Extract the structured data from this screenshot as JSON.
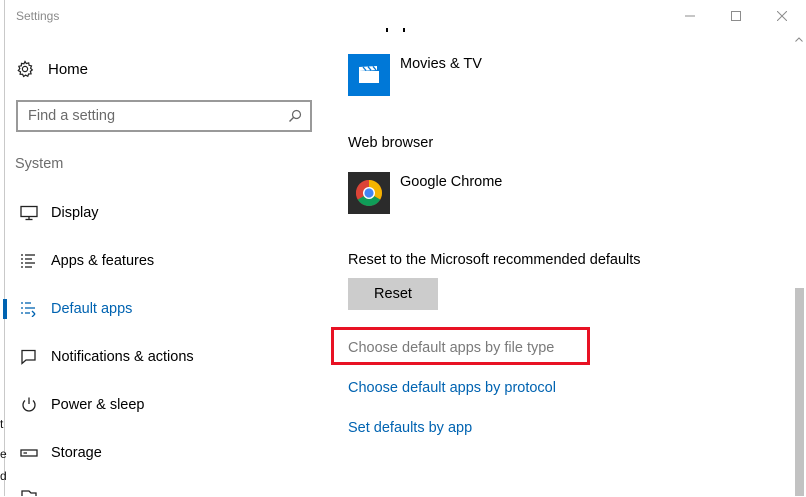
{
  "window": {
    "title": "Settings",
    "minimize_icon": "minimize-icon",
    "maximize_icon": "maximize-icon",
    "close_icon": "close-icon"
  },
  "background": {
    "fragments": [
      "t",
      "e",
      "d"
    ]
  },
  "sidebar": {
    "home_label": "Home",
    "search_placeholder": "Find a setting",
    "section_label": "System",
    "items": [
      {
        "label": "Display",
        "icon": "display-icon",
        "active": false
      },
      {
        "label": "Apps & features",
        "icon": "apps-list-icon",
        "active": false
      },
      {
        "label": "Default apps",
        "icon": "default-apps-icon",
        "active": true
      },
      {
        "label": "Notifications & actions",
        "icon": "notifications-icon",
        "active": false
      },
      {
        "label": "Power & sleep",
        "icon": "power-icon",
        "active": false
      },
      {
        "label": "Storage",
        "icon": "storage-icon",
        "active": false
      }
    ]
  },
  "main": {
    "video_player_app": {
      "name": "Movies & TV",
      "icon": "movies-tv-icon",
      "tile_color": "#0078d7"
    },
    "web_browser_heading": "Web browser",
    "web_browser_app": {
      "name": "Google Chrome",
      "icon": "chrome-icon",
      "tile_color": "#2b2b2b"
    },
    "reset_heading": "Reset to the Microsoft recommended defaults",
    "reset_button": "Reset",
    "links": {
      "by_file_type": "Choose default apps by file type",
      "by_protocol": "Choose default apps by protocol",
      "by_app": "Set defaults by app"
    }
  },
  "colors": {
    "accent": "#0063b1",
    "highlight_box": "#e81123",
    "reset_button_bg": "#cccccc"
  }
}
